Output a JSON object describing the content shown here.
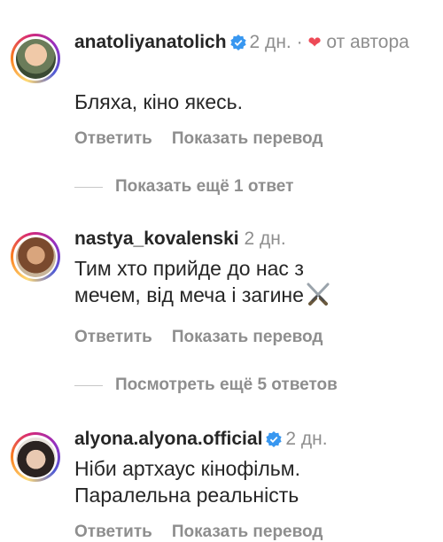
{
  "comments": [
    {
      "username": "anatoliyanatolich",
      "verified": true,
      "time": "2 дн.",
      "liked_by_author_sep": "·",
      "liked_by_author_icon": "heart-icon",
      "liked_by_author_text": "от автора",
      "text": "Бляха, кіно якесь.",
      "reply": "Ответить",
      "translate": "Показать перевод"
    },
    {
      "username": "nastya_kovalenski",
      "verified": false,
      "time": "2 дн.",
      "text_line1": "Тим хто прийде до нас з",
      "text_line2": "мечем, від меча і загине",
      "emoji": "crossed-swords-icon",
      "reply": "Ответить",
      "translate": "Показать перевод"
    },
    {
      "username": "alyona.alyona.official",
      "verified": true,
      "time": "2 дн.",
      "text_line1": "Ніби артхаус кінофільм.",
      "text_line2": "Паралельна реальність",
      "reply": "Ответить",
      "translate": "Показать перевод"
    }
  ],
  "more_replies_1": "Показать ещё 1 ответ",
  "more_replies_2": "Посмотреть ещё 5 ответов",
  "colors": {
    "verified": "#3897f0",
    "heart": "#ed4956",
    "secondary_text": "#8e8e8e",
    "primary_text": "#262626"
  }
}
